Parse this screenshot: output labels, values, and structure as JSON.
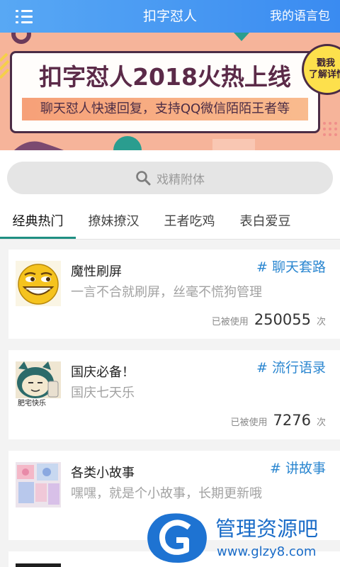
{
  "header": {
    "title": "扣字怼人",
    "right_label": "我的语言包",
    "menu_icon": "list-menu-icon"
  },
  "banner": {
    "headline": "扣字怼人2018火热上线",
    "subline": "聊天怼人快速回复，支持QQ微信陌陌王者等",
    "badge": {
      "line1": "戳我",
      "line2": "了解详情"
    }
  },
  "search": {
    "placeholder": "戏精附体",
    "icon": "search-icon"
  },
  "tabs": [
    {
      "label": "经典热门",
      "active": true
    },
    {
      "label": "撩妹撩汉",
      "active": false
    },
    {
      "label": "王者吃鸡",
      "active": false
    },
    {
      "label": "表白爱豆",
      "active": false
    }
  ],
  "items": [
    {
      "title": "魔性刷屏",
      "tag": "# 聊天套路",
      "subtitle": "一言不合就刷屏，丝毫不慌狗管理",
      "usage": {
        "prefix": "已被使用",
        "count": "250055",
        "suffix": "次"
      },
      "avatar": "grinning-face-icon"
    },
    {
      "title": "国庆必备！",
      "tag": "# 流行语录",
      "subtitle": "国庆七天乐",
      "usage": {
        "prefix": "已被使用",
        "count": "7276",
        "suffix": "次"
      },
      "avatar": "snorlax-meme-image",
      "avatar_text": "肥宅快乐"
    },
    {
      "title": "各类小故事",
      "tag": "# 讲故事",
      "subtitle": "嘿嘿，就是个小故事，长期更新哦",
      "avatar": "collage-photo-image"
    },
    {
      "avatar": "dark-photo-image"
    }
  ],
  "watermark": {
    "name": "管理资源吧",
    "url": "www.glzy8.com"
  },
  "colors": {
    "header_start": "#58a8f4",
    "header_end": "#3a8bf1",
    "tab_accent": "#1f8f82",
    "tag_blue": "#2a86d0",
    "banner_bg": "#f6b49a",
    "badge_yellow": "#fde04c"
  }
}
